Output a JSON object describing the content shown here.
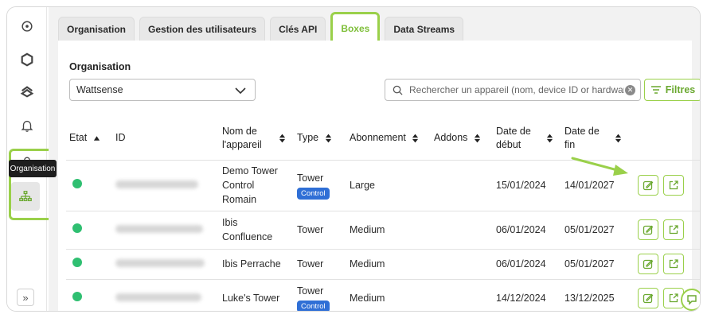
{
  "sidebar": {
    "icons": [
      "location-pin-icon",
      "hexagon-logo-icon",
      "stack-icon",
      "bell-icon",
      "org-chart-icon"
    ],
    "tooltip": "Organisation",
    "expand_label": "»"
  },
  "tabs": [
    {
      "label": "Organisation",
      "active": false
    },
    {
      "label": "Gestion des utilisateurs",
      "active": false
    },
    {
      "label": "Clés API",
      "active": false
    },
    {
      "label": "Boxes",
      "active": true
    },
    {
      "label": "Data Streams",
      "active": false
    }
  ],
  "filters": {
    "organisation_label": "Organisation",
    "organisation_value": "Wattsense",
    "search_placeholder": "Rechercher un appareil (nom, device ID or hardware ID)",
    "filter_button": "Filtres"
  },
  "table": {
    "headers": {
      "etat": "Etat",
      "id": "ID",
      "nom": "Nom de l'appareil",
      "type": "Type",
      "abonnement": "Abonnement",
      "addons": "Addons",
      "debut": "Date de début",
      "fin": "Date de fin"
    },
    "rows": [
      {
        "name": "Demo Tower Control Romain",
        "type": "Tower",
        "badge": "Control",
        "abonnement": "Large",
        "addons": "",
        "debut": "15/01/2024",
        "fin": "14/01/2027"
      },
      {
        "name": "Ibis Confluence",
        "type": "Tower",
        "badge": "",
        "abonnement": "Medium",
        "addons": "",
        "debut": "06/01/2024",
        "fin": "05/01/2027"
      },
      {
        "name": "Ibis Perrache",
        "type": "Tower",
        "badge": "",
        "abonnement": "Medium",
        "addons": "",
        "debut": "06/01/2024",
        "fin": "05/01/2027"
      },
      {
        "name": "Luke's Tower",
        "type": "Tower",
        "badge": "Control",
        "abonnement": "Medium",
        "addons": "",
        "debut": "14/12/2024",
        "fin": "13/12/2025"
      }
    ]
  },
  "colors": {
    "accent_green": "#9ad04a",
    "status_online": "#2fbf71",
    "badge_blue": "#2f6fd6"
  }
}
